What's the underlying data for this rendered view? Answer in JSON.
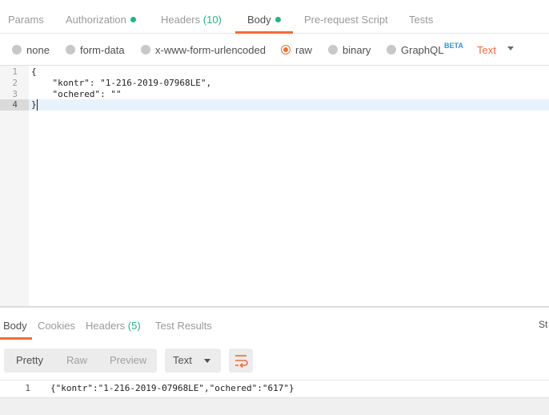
{
  "request_tabs": [
    {
      "label": "Params"
    },
    {
      "label": "Authorization"
    },
    {
      "label": "Headers",
      "count": "(10)"
    },
    {
      "label": "Body"
    },
    {
      "label": "Pre-request Script"
    },
    {
      "label": "Tests"
    }
  ],
  "body_types": {
    "none": "none",
    "form_data": "form-data",
    "urlencoded": "x-www-form-urlencoded",
    "raw": "raw",
    "binary": "binary",
    "graphql": "GraphQL",
    "beta": "BETA",
    "content_type": "Text",
    "selected": "raw"
  },
  "editor": {
    "lines": [
      {
        "num": "1",
        "text": "{"
      },
      {
        "num": "2",
        "text": "    \"kontr\": \"1-216-2019-07968LE\","
      },
      {
        "num": "3",
        "text": "    \"ochered\": \"\""
      },
      {
        "num": "4",
        "text": "}"
      }
    ],
    "current_line": "4"
  },
  "response": {
    "tabs": [
      {
        "label": "Body"
      },
      {
        "label": "Cookies"
      },
      {
        "label": "Headers",
        "count": "(5)"
      },
      {
        "label": "Test Results"
      }
    ],
    "status_cut": "St",
    "formats": {
      "pretty": "Pretty",
      "raw": "Raw",
      "preview": "Preview"
    },
    "language": "Text",
    "lines": [
      {
        "num": "1",
        "text": "{\"kontr\":\"1-216-2019-07968LE\",\"ochered\":\"617\"}"
      }
    ]
  },
  "colors": {
    "accent": "#f26b3a",
    "green": "#26b47f",
    "beta": "#3d8fd8"
  }
}
